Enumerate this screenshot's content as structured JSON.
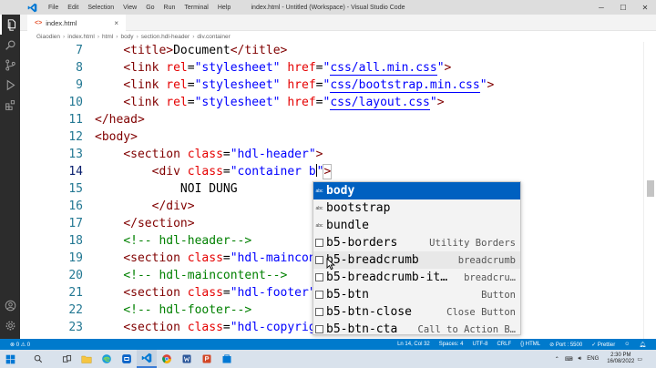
{
  "window": {
    "title": "index.html - Untitled (Workspace) - Visual Studio Code",
    "menu": [
      "File",
      "Edit",
      "Selection",
      "View",
      "Go",
      "Run",
      "Terminal",
      "Help"
    ]
  },
  "tabs": [
    {
      "label": "index.html",
      "close": "×"
    }
  ],
  "breadcrumb": [
    "Giaodien",
    "index.html",
    "html",
    "body",
    "section.hdl-header",
    "div.container"
  ],
  "editor": {
    "lines": [
      {
        "num": "7"
      },
      {
        "num": "8"
      },
      {
        "num": "9"
      },
      {
        "num": "10"
      },
      {
        "num": "11"
      },
      {
        "num": "12"
      },
      {
        "num": "13"
      },
      {
        "num": "14"
      },
      {
        "num": "15"
      },
      {
        "num": "16"
      },
      {
        "num": "17"
      },
      {
        "num": "18"
      },
      {
        "num": "19"
      },
      {
        "num": "20"
      },
      {
        "num": "21"
      },
      {
        "num": "22"
      },
      {
        "num": "23"
      }
    ]
  },
  "suggest": {
    "items": [
      {
        "label": "body",
        "detail": "",
        "kind": "word"
      },
      {
        "label": "bootstrap",
        "detail": "",
        "kind": "word"
      },
      {
        "label": "bundle",
        "detail": "",
        "kind": "word"
      },
      {
        "label": "b5-borders",
        "detail": "Utility Borders",
        "kind": "snippet"
      },
      {
        "label": "b5-breadcrumb",
        "detail": "breadcrumb",
        "kind": "snippet"
      },
      {
        "label": "b5-breadcrumb-it…",
        "detail": "breadcru…",
        "kind": "snippet"
      },
      {
        "label": "b5-btn",
        "detail": "Button",
        "kind": "snippet"
      },
      {
        "label": "b5-btn-close",
        "detail": "Close Button",
        "kind": "snippet"
      },
      {
        "label": "b5-btn-cta",
        "detail": "Call to Action B…",
        "kind": "snippet"
      }
    ]
  },
  "statusbar": {
    "errors": "⊗ 0 ⚠ 0",
    "position": "Ln 14, Col 32",
    "spaces": "Spaces: 4",
    "encoding": "UTF-8",
    "eol": "CRLF",
    "language": "{} HTML",
    "port": "⊘ Port : 5500",
    "prettier": "✓ Prettier"
  },
  "taskbar": {
    "lang": "ENG",
    "time": "2:30 PM",
    "date": "16/08/2022"
  },
  "colors": {
    "statusbar": "#007acc",
    "activitybar": "#2c2c2c",
    "selection": "#0060c0"
  }
}
